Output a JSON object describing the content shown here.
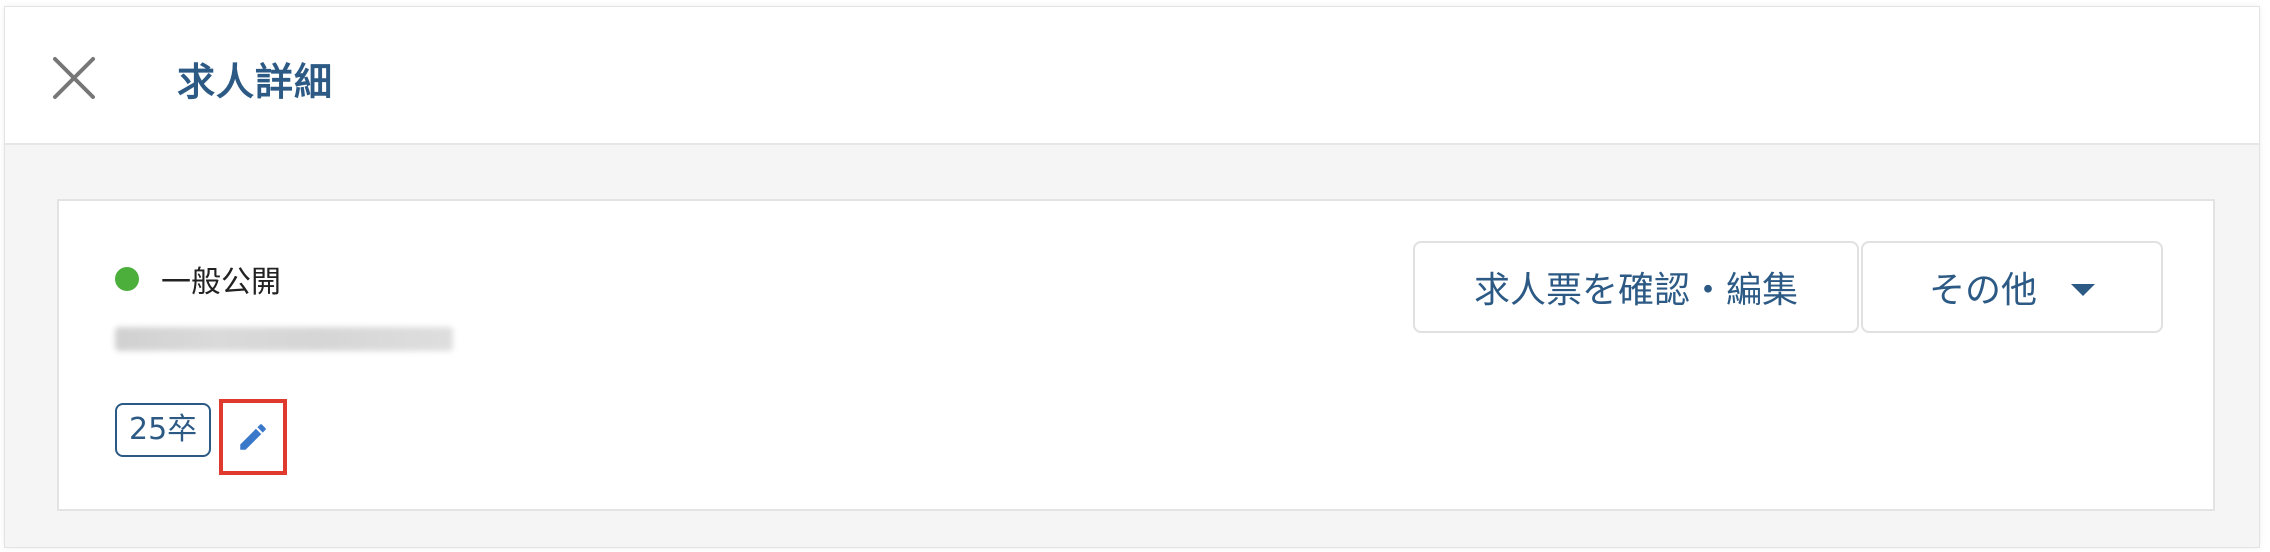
{
  "header": {
    "title": "求人詳細",
    "close_icon": "close-icon"
  },
  "job": {
    "status_label": "一般公開",
    "status_color": "#4caf3b",
    "tag_label": "25卒",
    "edit_icon": "pencil-icon"
  },
  "actions": {
    "confirm_edit_label": "求人票を確認・編集",
    "other_label": "その他",
    "other_icon": "chevron-down-icon"
  },
  "colors": {
    "accent": "#2c5a85",
    "highlight": "#e03a2f",
    "background": "#f5f5f5"
  }
}
